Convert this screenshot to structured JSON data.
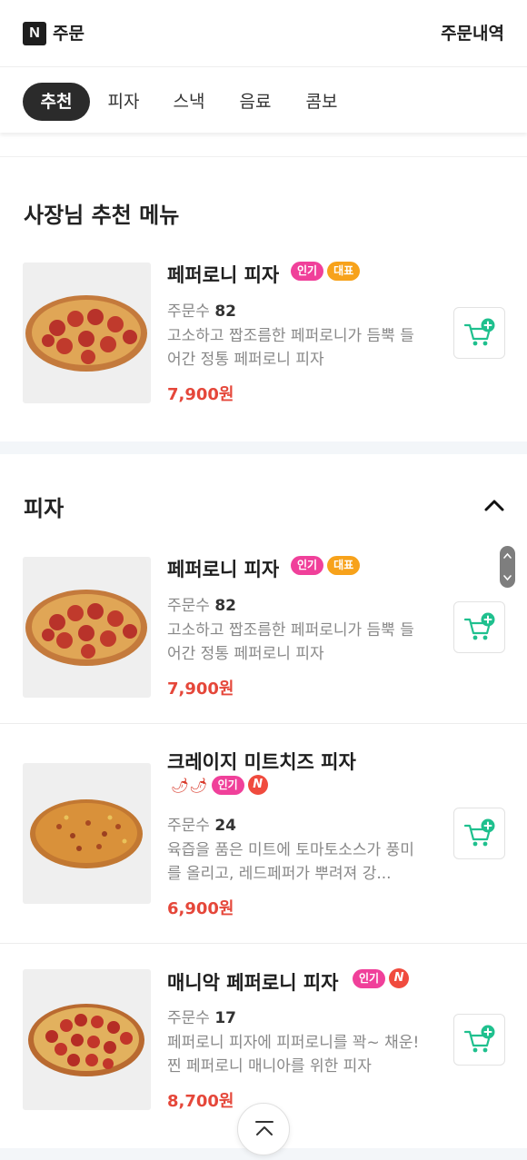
{
  "header": {
    "logo_letter": "N",
    "title": "주문",
    "order_history": "주문내역"
  },
  "tabs": [
    {
      "label": "추천",
      "active": true
    },
    {
      "label": "피자",
      "active": false
    },
    {
      "label": "스낵",
      "active": false
    },
    {
      "label": "음료",
      "active": false
    },
    {
      "label": "콤보",
      "active": false
    }
  ],
  "recommend": {
    "title": "사장님 추천 메뉴",
    "items": [
      {
        "name": "페퍼로니 피자",
        "badges": [
          "인기",
          "대표"
        ],
        "order_label": "주문수",
        "order_count": "82",
        "desc": "고소하고 짭조름한 페퍼로니가 듬뿍 들어간 정통 페퍼로니 피자",
        "price": "7,900원"
      }
    ]
  },
  "pizza": {
    "title": "피자",
    "items": [
      {
        "name": "페퍼로니 피자",
        "badges": [
          "인기",
          "대표"
        ],
        "order_label": "주문수",
        "order_count": "82",
        "desc": "고소하고 짭조름한 페퍼로니가 듬뿍 들어간 정통 페퍼로니 피자",
        "price": "7,900원"
      },
      {
        "name": "크레이지 미트치즈 피자",
        "badges": [
          "인기"
        ],
        "spicy": "🌶🌶",
        "new_badge": "N",
        "order_label": "주문수",
        "order_count": "24",
        "desc": "육즙을 품은 미트에 토마토소스가 풍미를 올리고, 레드페퍼가 뿌려져 강...",
        "price": "6,900원"
      },
      {
        "name": "매니악 페퍼로니 피자",
        "badges": [
          "인기"
        ],
        "new_badge": "N",
        "order_label": "주문수",
        "order_count": "17",
        "desc": "페퍼로니 피자에 피퍼로니를 꽉~ 채운! 찐 페퍼로니 매니아를 위한 피자",
        "price": "8,700원"
      }
    ]
  },
  "colors": {
    "accent_price": "#e5473a",
    "badge_popular": "#f0409a",
    "badge_signature": "#f7a21b",
    "cart_green": "#1fc08e",
    "new_badge": "#f04b3e"
  },
  "icons": {
    "cart": "cart-plus-icon",
    "collapse": "chevron-up-icon",
    "scroll_top": "arrow-up-icon"
  }
}
